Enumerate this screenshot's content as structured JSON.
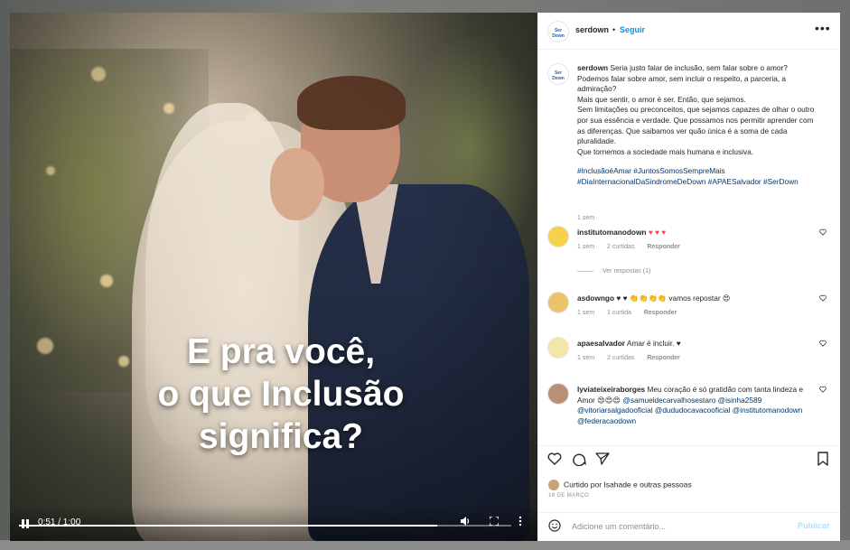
{
  "video": {
    "overlay_lines": [
      "E pra você,",
      "o que Inclusão",
      "significa?"
    ],
    "time": "0:51 / 1:00",
    "progress_fraction": 0.85
  },
  "post": {
    "author": "serdown",
    "separator": "•",
    "follow_label": "Seguir",
    "more_label": "•••",
    "avatar_text": "Ser Down"
  },
  "caption": {
    "author": "serdown",
    "lines": [
      "Seria justo falar de inclusão, sem falar sobre o amor? Podemos falar sobre amor, sem incluir o respeito, a parceria, a admiração?",
      "Mais que sentir, o amor é ser. Então, que sejamos.",
      "Sem limitações ou preconceitos, que sejamos capazes de olhar o outro por sua essência e verdade. Que possamos nos permitir aprender com as diferenças. Que saibamos ver quão única é a soma de cada pluralidade.",
      "Que tornemos a sociedade mais humana e inclusiva."
    ],
    "hashtags": "#InclusãoéAmar #JuntosSomosSempreMais #DiaInternacionalDaSindromeDeDown #APAESalvador #SerDown",
    "time": "1 sem"
  },
  "comments": [
    {
      "user": "institutomanodown",
      "text": "♥ ♥ ♥",
      "time": "1 sem",
      "likes": "2 curtidas",
      "reply": "Responder",
      "view_replies": "Ver respostas (1)",
      "avatar_color": "#f5d24a"
    },
    {
      "user": "asdowngo",
      "text": "♥ ♥ 👏👏👏👏 vamos repostar 😍",
      "time": "1 sem",
      "likes": "1 curtida",
      "reply": "Responder",
      "avatar_color": "#e9c46a"
    },
    {
      "user": "apaesalvador",
      "text": "Amar é incluir. ♥",
      "time": "1 sem",
      "likes": "2 curtidas",
      "reply": "Responder",
      "avatar_color": "#f2e6a8"
    },
    {
      "user": "lyviateixeiraborges",
      "text": "Meu coração é só gratidão com tanta lindeza e Amor 😍😍😍",
      "mentions": "@samueldecarvalhosestaro @isinha2589 @vitoriarsalgadooficial @dududocavacooficial @institutomanodown @federacaodown",
      "avatar_color": "#b89078"
    }
  ],
  "liked_by": "Curtido por Isahade e outras pessoas",
  "date": "19 DE MARÇO",
  "add_comment": {
    "placeholder": "Adicione um comentário...",
    "publish_label": "Publicar"
  }
}
